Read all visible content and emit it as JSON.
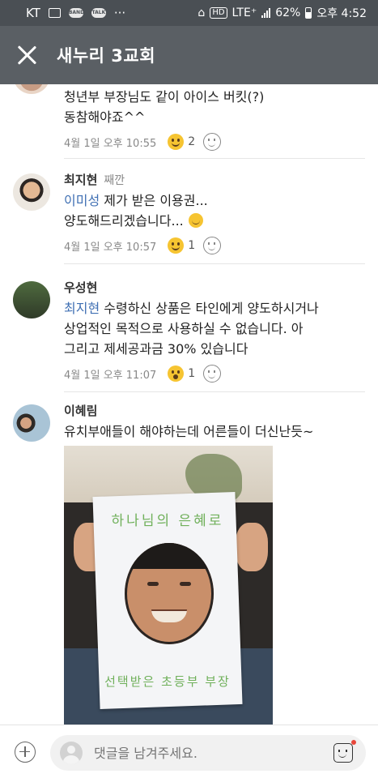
{
  "status_bar": {
    "carrier": "KT",
    "icons": [
      "image-icon",
      "band-icon",
      "kakaotalk-icon",
      "more-dots-icon"
    ],
    "hd_label": "HD",
    "network": "LTE⁺",
    "battery": "62%",
    "time": "오후 4:52"
  },
  "header": {
    "title": "새누리 3교회"
  },
  "comments": [
    {
      "name": "",
      "text": "청년부 부장님도 같이 아이스 버킷(?)\n동참해야죠^^",
      "time": "4월 1일 오후 10:55",
      "reaction": {
        "icon": "smile-emoji-icon",
        "count": "2"
      }
    },
    {
      "name": "최지현",
      "sub": "째깐",
      "mention": "이미성",
      "text_l1": "제가 받은 이용권...",
      "text_l2": "양도해드리겠습니다...",
      "time": "4월 1일 오후 10:57",
      "reaction": {
        "icon": "laugh-emoji-icon",
        "count": "1"
      }
    },
    {
      "name": "우성현",
      "mention": "최지현",
      "text_l1": "수령하신 상품은 타인에게 양도하시거나",
      "text_l2": "상업적인 목적으로 사용하실 수 없습니다. 아",
      "text_l3": "그리고 제세공과금 30% 있습니다",
      "time": "4월 1일 오후 11:07",
      "reaction": {
        "icon": "surprised-emoji-icon",
        "count": "1"
      }
    },
    {
      "name": "이혜림",
      "text": "유치부애들이 해야하는데 어른들이 더신난듯~",
      "photo": {
        "paper_top": "하나님의 은혜로",
        "paper_bottom": "선택받은 초등부 부장"
      }
    }
  ],
  "composer": {
    "placeholder": "댓글을 남겨주세요."
  },
  "colors": {
    "header_bg": "#5a5f64",
    "mention": "#3f6fb3",
    "emoji": "#f6c431"
  }
}
